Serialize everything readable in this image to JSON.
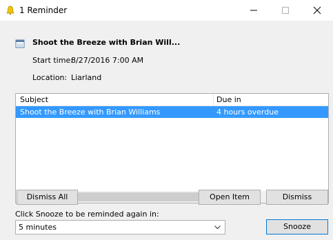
{
  "window": {
    "title": "1 Reminder"
  },
  "reminder": {
    "subject_title": "Shoot the Breeze with Brian Will...",
    "start_label": "Start time:",
    "start_value": "8/27/2016 7:00 AM",
    "location_label": "Location:",
    "location_value": "Liarland"
  },
  "list": {
    "columns": [
      "Subject",
      "Due in"
    ],
    "rows": [
      {
        "subject": "Shoot the Breeze with Brian Williams",
        "due": "4 hours overdue"
      }
    ]
  },
  "buttons": {
    "dismiss_all": "Dismiss All",
    "open_item": "Open Item",
    "dismiss": "Dismiss",
    "snooze": "Snooze"
  },
  "snooze": {
    "label": "Click Snooze to be reminded again in:",
    "selected": "5 minutes"
  },
  "icons": {
    "title": "bell-icon",
    "header": "calendar-icon",
    "minimize": "minimize-icon",
    "maximize": "maximize-icon",
    "close": "close-icon",
    "scroll_left": "scroll-left-icon",
    "scroll_right": "scroll-right-icon",
    "dropdown": "chevron-down-icon"
  },
  "colors": {
    "selection": "#3399ff",
    "bell": "#f2c500"
  }
}
